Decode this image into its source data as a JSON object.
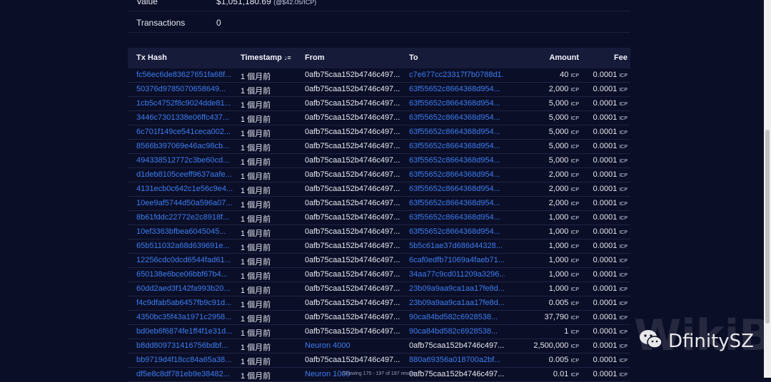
{
  "summary": {
    "value_label": "Value",
    "value_amount": "$1,051,180.69",
    "value_rate": "(@$42.05/ICP)",
    "transactions_label": "Transactions",
    "transactions_value": "0"
  },
  "table": {
    "columns": [
      "Tx Hash",
      "Timestamp",
      "From",
      "To",
      "Amount",
      "Fee"
    ],
    "unit": "ICP",
    "rows": [
      {
        "hash": "fc56ec6de83627651fa68f...",
        "ts": "1 個月前",
        "from": "0afb75caa152b4746c497...",
        "to": "c7e677cc23317f7b0788d1...",
        "amount": "40",
        "fee": "0.0001",
        "from_link": false,
        "to_link": true
      },
      {
        "hash": "50376d9785070658649...",
        "ts": "1 個月前",
        "from": "0afb75caa152b4746c497...",
        "to": "63f55652c8664368d954...",
        "amount": "2,000",
        "fee": "0.0001",
        "from_link": false,
        "to_link": true
      },
      {
        "hash": "1cb5c4752f8c9024dde81...",
        "ts": "1 個月前",
        "from": "0afb75caa152b4746c497...",
        "to": "63f55652c8664368d954...",
        "amount": "5,000",
        "fee": "0.0001",
        "from_link": false,
        "to_link": true
      },
      {
        "hash": "3446c7301338e06ffc437...",
        "ts": "1 個月前",
        "from": "0afb75caa152b4746c497...",
        "to": "63f55652c8664368d954...",
        "amount": "5,000",
        "fee": "0.0001",
        "from_link": false,
        "to_link": true
      },
      {
        "hash": "6c701f149ce541ceca002...",
        "ts": "1 個月前",
        "from": "0afb75caa152b4746c497...",
        "to": "63f55652c8664368d954...",
        "amount": "5,000",
        "fee": "0.0001",
        "from_link": false,
        "to_link": true
      },
      {
        "hash": "8566b397069e46ac98cb...",
        "ts": "1 個月前",
        "from": "0afb75caa152b4746c497...",
        "to": "63f55652c8664368d954...",
        "amount": "5,000",
        "fee": "0.0001",
        "from_link": false,
        "to_link": true
      },
      {
        "hash": "494338512772c3be60cd...",
        "ts": "1 個月前",
        "from": "0afb75caa152b4746c497...",
        "to": "63f55652c8664368d954...",
        "amount": "5,000",
        "fee": "0.0001",
        "from_link": false,
        "to_link": true
      },
      {
        "hash": "d1deb8105ceeff9637aafe...",
        "ts": "1 個月前",
        "from": "0afb75caa152b4746c497...",
        "to": "63f55652c8664368d954...",
        "amount": "2,000",
        "fee": "0.0001",
        "from_link": false,
        "to_link": true
      },
      {
        "hash": "4131ecb0c642c1e56c9e4...",
        "ts": "1 個月前",
        "from": "0afb75caa152b4746c497...",
        "to": "63f55652c8664368d954...",
        "amount": "2,000",
        "fee": "0.0001",
        "from_link": false,
        "to_link": true
      },
      {
        "hash": "10ee9af5744d50a596a07...",
        "ts": "1 個月前",
        "from": "0afb75caa152b4746c497...",
        "to": "63f55652c8664368d954...",
        "amount": "2,000",
        "fee": "0.0001",
        "from_link": false,
        "to_link": true
      },
      {
        "hash": "8b61fddc22772e2c8918f...",
        "ts": "1 個月前",
        "from": "0afb75caa152b4746c497...",
        "to": "63f55652c8664368d954...",
        "amount": "1,000",
        "fee": "0.0001",
        "from_link": false,
        "to_link": true
      },
      {
        "hash": "10ef3363bfbea6045045...",
        "ts": "1 個月前",
        "from": "0afb75caa152b4746c497...",
        "to": "63f55652c8664368d954...",
        "amount": "1,000",
        "fee": "0.0001",
        "from_link": false,
        "to_link": true
      },
      {
        "hash": "65b511032a68d639691e...",
        "ts": "1 個月前",
        "from": "0afb75caa152b4746c497...",
        "to": "5b5c61ae37d686d44328...",
        "amount": "1,000",
        "fee": "0.0001",
        "from_link": false,
        "to_link": true
      },
      {
        "hash": "12256cdc0dcd6544fad61...",
        "ts": "1 個月前",
        "from": "0afb75caa152b4746c497...",
        "to": "6caf0edfb71069a4faeb71...",
        "amount": "1,000",
        "fee": "0.0001",
        "from_link": false,
        "to_link": true
      },
      {
        "hash": "650138e6bce06bbf67b4...",
        "ts": "1 個月前",
        "from": "0afb75caa152b4746c497...",
        "to": "34aa77c9cd011209a3296...",
        "amount": "1,000",
        "fee": "0.0001",
        "from_link": false,
        "to_link": true
      },
      {
        "hash": "60dd2aed3f142fa993b20...",
        "ts": "1 個月前",
        "from": "0afb75caa152b4746c497...",
        "to": "23b09a9aa9ca1aa17fe8d...",
        "amount": "1,000",
        "fee": "0.0001",
        "from_link": false,
        "to_link": true
      },
      {
        "hash": "f4c9dfab5ab6457fb9c91d...",
        "ts": "1 個月前",
        "from": "0afb75caa152b4746c497...",
        "to": "23b09a9aa9ca1aa17fe8d...",
        "amount": "0.005",
        "fee": "0.0001",
        "from_link": false,
        "to_link": true
      },
      {
        "hash": "4350bc35f43a1971c2958...",
        "ts": "1 個月前",
        "from": "0afb75caa152b4746c497...",
        "to": "90ca84bd582c6928538...",
        "amount": "37,790",
        "fee": "0.0001",
        "from_link": false,
        "to_link": true
      },
      {
        "hash": "bd0eb6f6874fe1ff4f1e31d...",
        "ts": "1 個月前",
        "from": "0afb75caa152b4746c497...",
        "to": "90ca84bd582c6928538...",
        "amount": "1",
        "fee": "0.0001",
        "from_link": false,
        "to_link": true
      },
      {
        "hash": "b8dd809731416756bdbf...",
        "ts": "1 個月前",
        "from": "Neuron 4000",
        "to": "0afb75caa152b4746c497...",
        "amount": "2,500,000",
        "fee": "0.0001",
        "from_link": true,
        "to_link": false
      },
      {
        "hash": "bb9719d4f18cc84a65a38...",
        "ts": "1 個月前",
        "from": "0afb75caa152b4746c497...",
        "to": "880a69356a018700a2bf...",
        "amount": "0.005",
        "fee": "0.0001",
        "from_link": false,
        "to_link": true
      },
      {
        "hash": "df5e8c8df781eb9e38482...",
        "ts": "1 個月前",
        "from": "Neuron 1000",
        "to": "0afb75caa152b4746c497...",
        "amount": "0.01",
        "fee": "0.0001",
        "from_link": true,
        "to_link": false
      }
    ]
  },
  "footer": "Showing 175 - 197 of 197 results",
  "watermark": {
    "brand": "WikiBit",
    "name": "DfinitySZ"
  },
  "colors": {
    "background": "#0b0e27",
    "header": "#161b3a",
    "link": "#3c7ef0"
  }
}
